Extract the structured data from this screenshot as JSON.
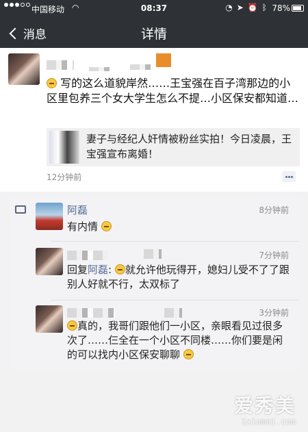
{
  "status_bar": {
    "carrier": "中国移动",
    "time": "08:37",
    "battery_pct": "78%"
  },
  "nav": {
    "back_label": "消息",
    "title": "详情"
  },
  "post": {
    "text": "写的这么道貌岸然……王宝强在百子湾那边的小区里包养三个女大学生怎么不提…小区保安都知道…",
    "link_title": "妻子与经纪人奸情被粉丝实拍！今日凌晨，王宝强宣布离婚！",
    "time": "12分钟前"
  },
  "comments": [
    {
      "name": "阿磊",
      "time": "8分钟前",
      "text": "有内情"
    },
    {
      "reply_prefix": "回复",
      "reply_to": "阿磊",
      "colon": ": ",
      "time": "7分钟前",
      "text": "就允许他玩得开，媳妇儿受不了了跟别人好就不行，太双标了"
    },
    {
      "time": "3分钟前",
      "text": "真的，我哥们跟他们一小区，亲眼看见过很多次了……仨全在一个小区不同楼……你们要是闲的可以找内小区保安聊聊"
    }
  ],
  "watermark": {
    "cn": "爱秀美",
    "en": "ixiumei.com"
  }
}
